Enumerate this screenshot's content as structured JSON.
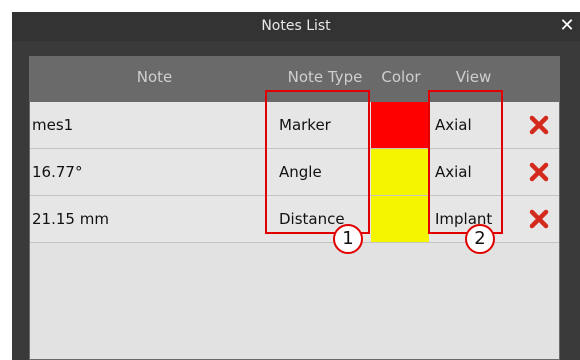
{
  "window": {
    "title": "Notes List",
    "close_glyph": "✕"
  },
  "columns": [
    {
      "label": "Note"
    },
    {
      "label": "Note Type"
    },
    {
      "label": "Color"
    },
    {
      "label": "View"
    }
  ],
  "rows": [
    {
      "note": "mes1",
      "type": "Marker",
      "color": "#ff0000",
      "view": "Axial"
    },
    {
      "note": "16.77°",
      "type": "Angle",
      "color": "#f5f500",
      "view": "Axial"
    },
    {
      "note": "21.15 mm",
      "type": "Distance",
      "color": "#f5f500",
      "view": "Implant"
    }
  ],
  "delete_icon": {
    "name": "delete-x-icon",
    "color": "#d42a1e"
  },
  "annotations": {
    "callout_1": "1",
    "callout_2": "2",
    "highlight_color": "#e00000"
  }
}
